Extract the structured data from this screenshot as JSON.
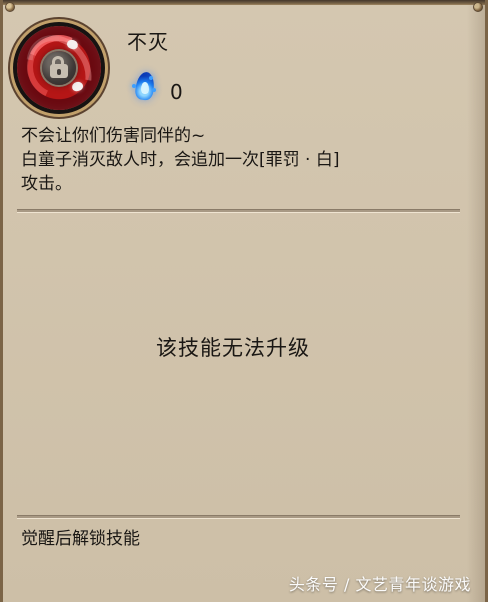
{
  "skill": {
    "name": "不灭",
    "cost_value": "0",
    "icon_name": "spirit-lock-icon",
    "cost_icon_name": "blue-soulfire-icon"
  },
  "description": {
    "lines": [
      "不会让你们伤害同伴的~",
      "白童子消灭敌人时，会追加一次[罪罚 · 白]",
      "攻击。"
    ]
  },
  "upgrade": {
    "status": "该技能无法升级"
  },
  "footer": {
    "unlock_text": "觉醒后解锁技能",
    "watermark": "头条号 / 文艺青年谈游戏"
  },
  "colors": {
    "panel_background": "#cfc1a9",
    "text": "#1a1714",
    "frame": "#7b6447",
    "skill_red": "#b51616",
    "soulfire_blue": "#1e7ff0"
  }
}
